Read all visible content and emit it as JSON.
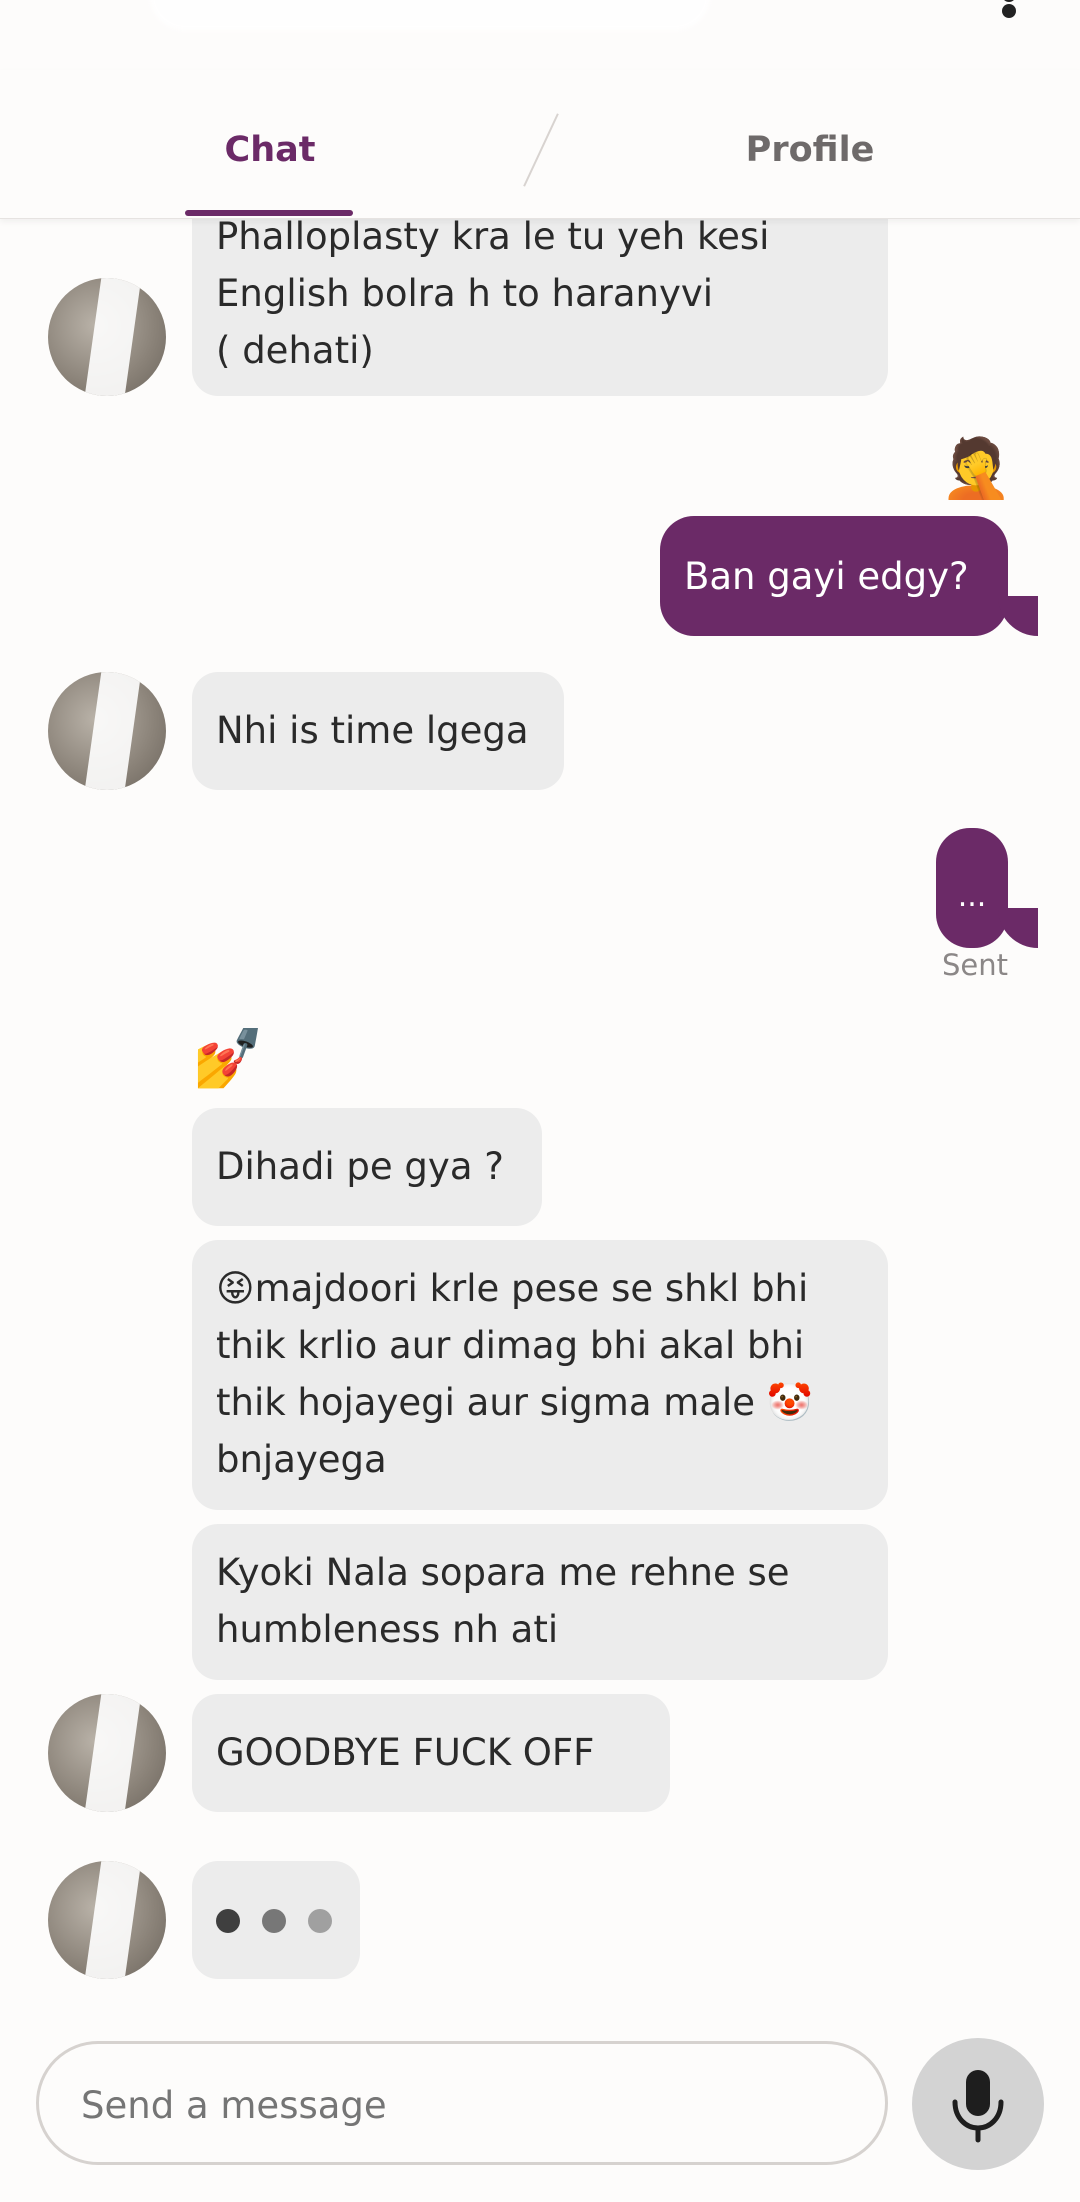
{
  "header": {
    "tabs": [
      {
        "label": "Chat",
        "active": true
      },
      {
        "label": "Profile",
        "active": false
      }
    ]
  },
  "messages": [
    {
      "side": "received",
      "text_lines": [
        "Phalloplasty kra le tu yeh kesi",
        "English bolra h to haranyvi",
        "( dehati)"
      ]
    },
    {
      "side": "sent",
      "reaction": "🤦",
      "text": "Ban gayi edgy?"
    },
    {
      "side": "received",
      "text": "Nhi is time lgega"
    },
    {
      "side": "sent",
      "text": "...",
      "status": "Sent"
    },
    {
      "side": "received",
      "reaction": "💅",
      "text": "Dihadi pe gya ?"
    },
    {
      "side": "received",
      "text_lines": [
        "😝majdoori krle pese se shkl bhi",
        "thik krlio aur dimag bhi akal bhi",
        "thik hojayegi aur sigma male 🤡",
        "bnjayega"
      ]
    },
    {
      "side": "received",
      "text_lines": [
        "Kyoki Nala sopara me rehne se",
        "humbleness nh ati"
      ]
    },
    {
      "side": "received",
      "text": "GOODBYE FUCK OFF"
    }
  ],
  "typing_indicator": true,
  "composer": {
    "placeholder": "Send a message"
  },
  "colors": {
    "accent": "#6b2a67",
    "received_bubble": "#ececec",
    "background": "#fdfcfb"
  }
}
